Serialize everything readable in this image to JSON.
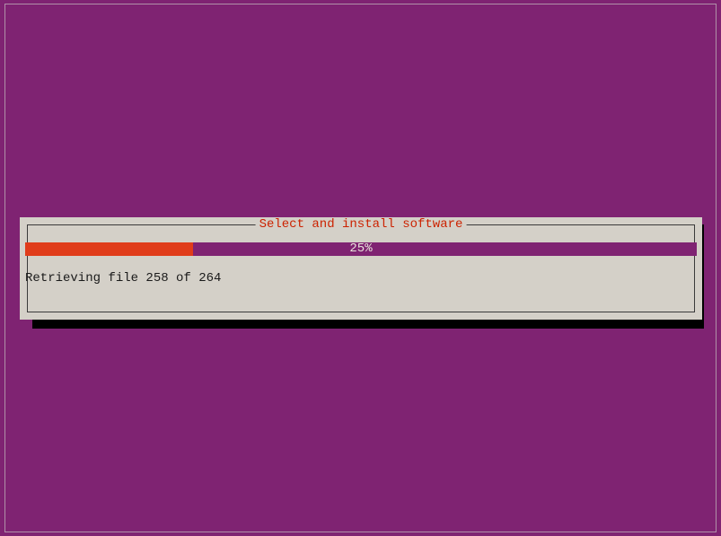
{
  "dialog": {
    "title": " Select and install software ",
    "progress_percent": 25,
    "progress_text": "25%",
    "status_text": "Retrieving file 258 of 264"
  },
  "colors": {
    "background": "#7f2372",
    "dialog_bg": "#d4d0c8",
    "progress_track": "#7f2372",
    "progress_fill": "#e03c1a",
    "title_color": "#cc2200",
    "shadow": "#000000"
  }
}
